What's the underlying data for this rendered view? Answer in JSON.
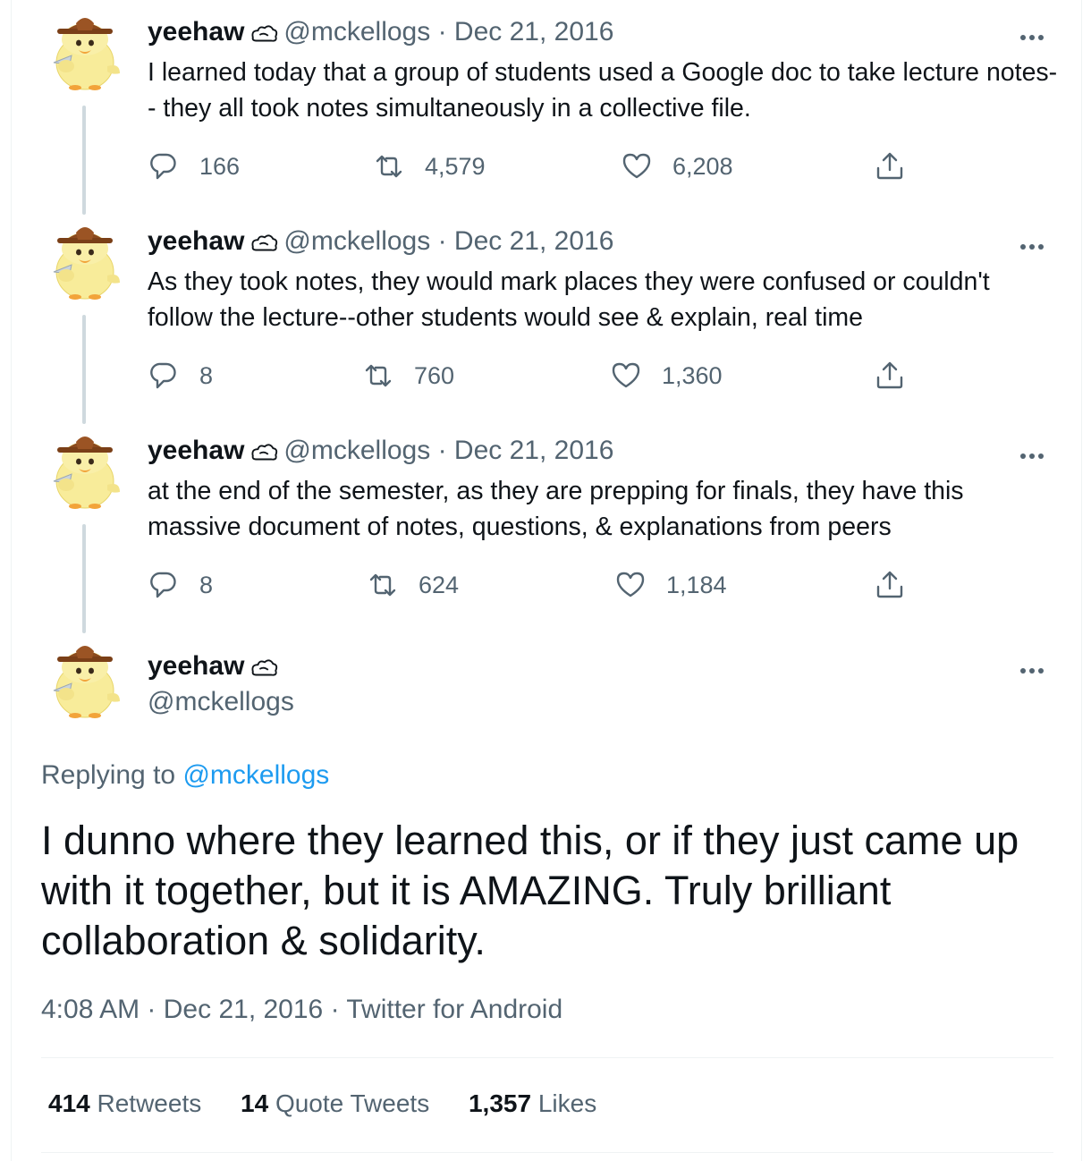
{
  "colors": {
    "text": "#0f1419",
    "secondary": "#536471",
    "accent": "#1d9bf0",
    "thread_line": "#cfd9de"
  },
  "thread": [
    {
      "name": "yeehaw",
      "handle": "@mckellogs",
      "sep": "·",
      "date": "Dec 21, 2016",
      "text": "I learned today that a group of students used a Google doc to take lecture notes-- they all took notes simultaneously in a collective file.",
      "replies": "166",
      "retweets": "4,579",
      "likes": "6,208"
    },
    {
      "name": "yeehaw",
      "handle": "@mckellogs",
      "sep": "·",
      "date": "Dec 21, 2016",
      "text": "As they took notes, they would mark places they were confused or couldn't follow the lecture--other students would see & explain, real time",
      "replies": "8",
      "retweets": "760",
      "likes": "1,360"
    },
    {
      "name": "yeehaw",
      "handle": "@mckellogs",
      "sep": "·",
      "date": "Dec 21, 2016",
      "text": "at the end of the semester, as they are prepping for finals, they have this massive document of notes, questions, & explanations from peers",
      "replies": "8",
      "retweets": "624",
      "likes": "1,184"
    }
  ],
  "main_tweet": {
    "name": "yeehaw",
    "handle": "@mckellogs",
    "replying_prefix": "Replying to",
    "replying_handle": "@mckellogs",
    "text": "I dunno where they learned this, or if they just came up with it together, but it is AMAZING. Truly brilliant collaboration & solidarity.",
    "time": "4:08 AM",
    "sep": "·",
    "date": "Dec 21, 2016",
    "source": "Twitter for Android",
    "retweets_count": "414",
    "retweets_label": "Retweets",
    "quote_count": "14",
    "quote_label": "Quote Tweets",
    "likes_count": "1,357",
    "likes_label": "Likes"
  },
  "icons": {
    "reply": "speech-bubble-icon",
    "retweet": "retweet-arrows-icon",
    "like": "heart-icon",
    "share": "upload-share-icon",
    "more": "ellipsis-icon",
    "badge": "cloud-scribble-icon"
  }
}
